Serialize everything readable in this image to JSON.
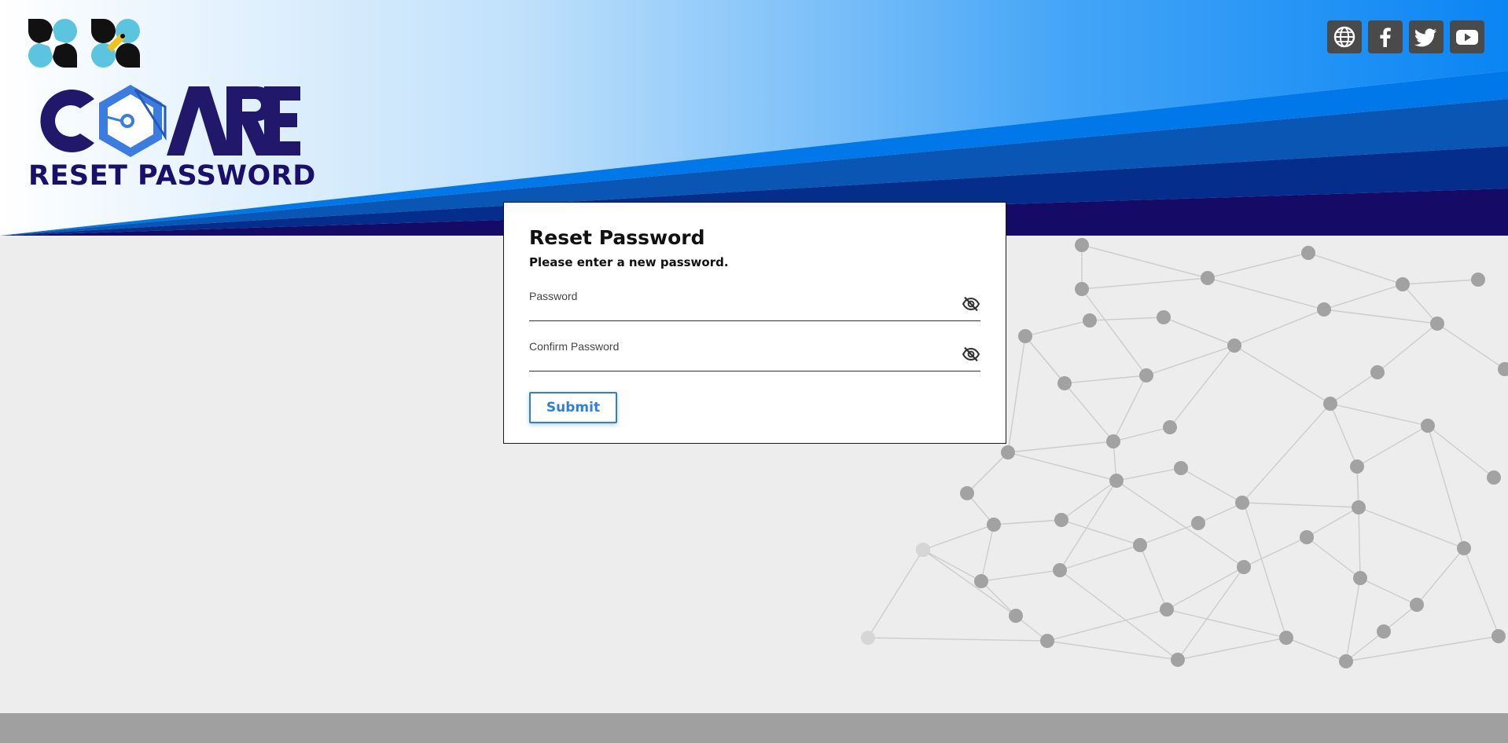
{
  "header": {
    "brand_sub_title": "RESET PASSWORD",
    "logo_text": "COARE",
    "social": [
      {
        "name": "globe-icon",
        "label": "Website"
      },
      {
        "name": "facebook-icon",
        "label": "Facebook"
      },
      {
        "name": "twitter-icon",
        "label": "Twitter"
      },
      {
        "name": "youtube-icon",
        "label": "YouTube"
      }
    ]
  },
  "form": {
    "title": "Reset Password",
    "subtitle": "Please enter a new password.",
    "password_label": "Password",
    "password_value": "",
    "confirm_label": "Confirm Password",
    "confirm_value": "",
    "submit_label": "Submit"
  },
  "colors": {
    "brand_navy": "#1a0f6b",
    "accent_blue": "#0080f0",
    "button_blue": "#2f7fd6",
    "footer_gray": "#a0a0a0"
  }
}
